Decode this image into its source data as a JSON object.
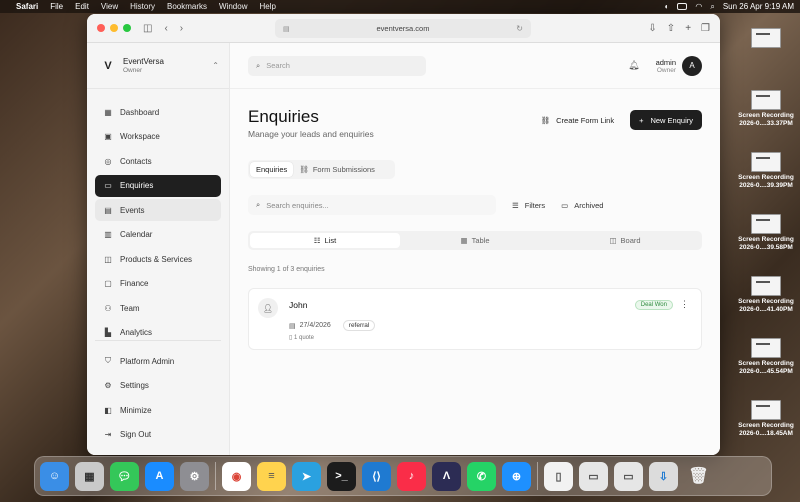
{
  "menubar": {
    "apple": "",
    "items": [
      "Safari",
      "File",
      "Edit",
      "View",
      "History",
      "Bookmarks",
      "Window",
      "Help"
    ],
    "datetime": "Sun 26 Apr  9:19 AM"
  },
  "desktop": {
    "files": [
      {
        "name": "",
        "sub": ""
      },
      {
        "name": "Screen Recording",
        "sub": "2026-0....33.37PM"
      },
      {
        "name": "Screen Recording",
        "sub": "2026-0....39.39PM"
      },
      {
        "name": "Screen Recording",
        "sub": "2026-0....39.58PM"
      },
      {
        "name": "Screen Recording",
        "sub": "2026-0....41.40PM"
      },
      {
        "name": "Screen Recording",
        "sub": "2026-0....45.54PM"
      },
      {
        "name": "Screen Recording",
        "sub": "2026-0....18.45AM"
      }
    ]
  },
  "browser": {
    "url": "eventversa.com"
  },
  "brand": {
    "logo": "V",
    "name": "EventVersa",
    "role": "Owner"
  },
  "sidebar": {
    "items": [
      {
        "label": "Dashboard",
        "icon": "dashboard-icon",
        "glyph": "▦"
      },
      {
        "label": "Workspace",
        "icon": "workspace-icon",
        "glyph": "▣"
      },
      {
        "label": "Contacts",
        "icon": "contacts-icon",
        "glyph": "◎"
      },
      {
        "label": "Enquiries",
        "icon": "enquiries-icon",
        "glyph": "▭"
      },
      {
        "label": "Events",
        "icon": "events-icon",
        "glyph": "▤"
      },
      {
        "label": "Calendar",
        "icon": "calendar-icon",
        "glyph": "▥"
      },
      {
        "label": "Products & Services",
        "icon": "products-icon",
        "glyph": "◫"
      },
      {
        "label": "Finance",
        "icon": "finance-icon",
        "glyph": "▢"
      },
      {
        "label": "Team",
        "icon": "team-icon",
        "glyph": "⚇"
      },
      {
        "label": "Analytics",
        "icon": "analytics-icon",
        "glyph": "▙"
      }
    ],
    "bottom": [
      {
        "label": "Platform Admin",
        "icon": "shield-icon",
        "glyph": "⛉"
      },
      {
        "label": "Settings",
        "icon": "gear-icon",
        "glyph": "⚙"
      },
      {
        "label": "Minimize",
        "icon": "minimize-icon",
        "glyph": "◧"
      },
      {
        "label": "Sign Out",
        "icon": "sign-out-icon",
        "glyph": "⇥"
      }
    ]
  },
  "topbar": {
    "search_placeholder": "Search",
    "user_name": "admin",
    "user_role": "Owner",
    "avatar_initial": "A"
  },
  "page": {
    "title": "Enquiries",
    "subtitle": "Manage your leads and enquiries",
    "create_form_link": "Create Form Link",
    "new_enquiry": "New Enquiry",
    "tabs": [
      "Enquiries",
      "Form Submissions"
    ],
    "search_placeholder": "Search enquiries...",
    "filters": "Filters",
    "archived": "Archived",
    "views": [
      "List",
      "Table",
      "Board"
    ],
    "showing": "Showing 1 of 3 enquiries"
  },
  "enquiries": [
    {
      "name": "John",
      "date": "27/4/2026",
      "source": "referral",
      "quotes": "1 quote",
      "status": "Deal Won"
    }
  ],
  "colors": {
    "accent": "#1f1f1f",
    "status_won": "#2e8b3e"
  }
}
